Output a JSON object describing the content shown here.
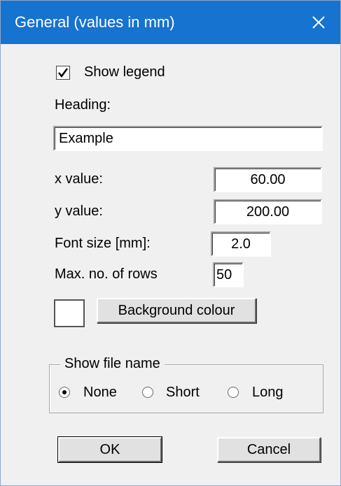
{
  "window": {
    "title": "General (values in mm)",
    "close_glyph": "✕"
  },
  "legend": {
    "show_legend_label": "Show legend",
    "show_legend_checked": true,
    "check_glyph": "✓",
    "heading_label": "Heading:",
    "heading_value": "Example",
    "x_label": "x value:",
    "x_value": "60.00",
    "y_label": "y value:",
    "y_value": "200.00",
    "font_size_label": "Font size [mm]:",
    "font_size_value": "2.0",
    "max_rows_label": "Max. no. of rows",
    "max_rows_value": "50",
    "background_button_label": "Background colour",
    "background_color": "#ffffff"
  },
  "file_name_group": {
    "caption": "Show file name",
    "options": [
      {
        "label": "None",
        "selected": true
      },
      {
        "label": "Short",
        "selected": false
      },
      {
        "label": "Long",
        "selected": false
      }
    ]
  },
  "buttons": {
    "ok_label": "OK",
    "cancel_label": "Cancel"
  },
  "colors": {
    "titlebar": "#1673cf",
    "dialog_bg": "#f0f0f0"
  }
}
